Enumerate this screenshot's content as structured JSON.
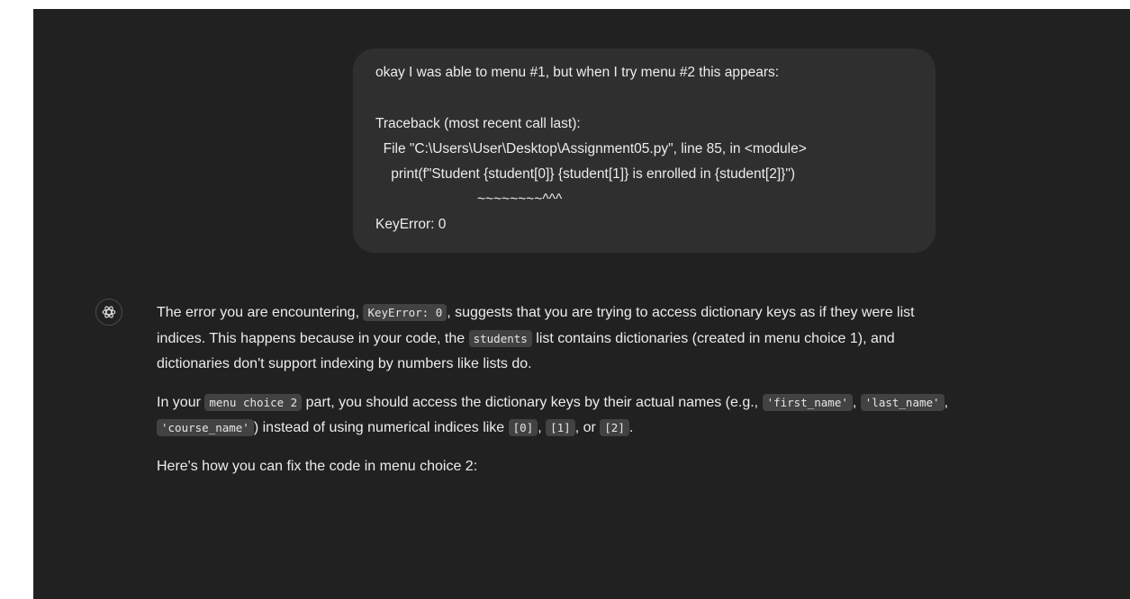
{
  "user_message": {
    "lines": [
      "okay I was able to menu #1, but when I try menu #2 this appears:",
      "Traceback (most recent call last):",
      "  File \"C:\\Users\\User\\Desktop\\Assignment05.py\", line 85, in <module>",
      "    print(f\"Student {student[0]} {student[1]} is enrolled in {student[2]}\")",
      "~~~~~~~~^^^",
      "KeyError: 0"
    ]
  },
  "assistant_message": {
    "avatar_icon": "openai-logo-icon",
    "p1": {
      "t1": "The error you are encountering, ",
      "c1": "KeyError: 0",
      "t2": ", suggests that you are trying to access dictionary keys as if they were list indices. This happens because in your code, the ",
      "c2": "students",
      "t3": " list contains dictionaries (created in menu choice 1), and dictionaries don't support indexing by numbers like lists do."
    },
    "p2": {
      "t1": "In your ",
      "c1": "menu choice 2",
      "t2": " part, you should access the dictionary keys by their actual names (e.g., ",
      "c2": "'first_name'",
      "t3": ", ",
      "c3": "'last_name'",
      "t4": ", ",
      "c4": "'course_name'",
      "t5": ") instead of using numerical indices like ",
      "c5": "[0]",
      "t6": ", ",
      "c6": "[1]",
      "t7": ", or ",
      "c7": "[2]",
      "t8": "."
    },
    "p3": {
      "t1": "Here's how you can fix the code in menu choice 2:"
    }
  }
}
